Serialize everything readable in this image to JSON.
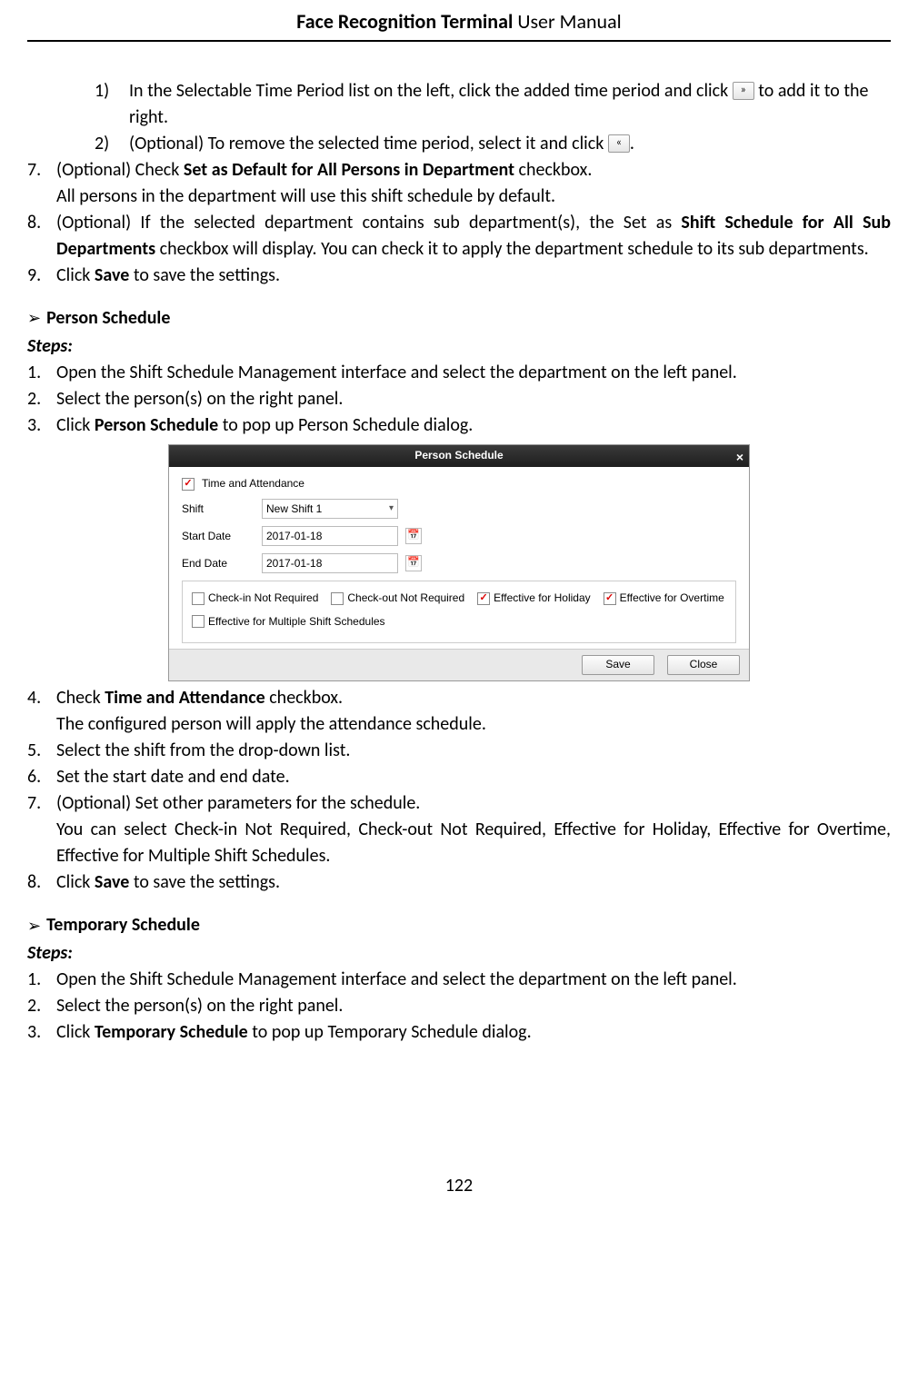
{
  "header": {
    "left": "Face Recognition Terminal",
    "right": " User Manual"
  },
  "page_number": "122",
  "icons": {
    "move_right": "»",
    "move_left": "«"
  },
  "buttons": {
    "save": "Save",
    "close": "Close"
  },
  "nums": {
    "s1": "1)",
    "s2": "2)",
    "n7": "7.",
    "n8": "8.",
    "n9": "9.",
    "p1": "1.",
    "p2": "2.",
    "p3": "3.",
    "p4": "4.",
    "p5": "5.",
    "p6": "6.",
    "p7": "7.",
    "p8": "8.",
    "t1": "1.",
    "t2": "2.",
    "t3": "3."
  },
  "top": {
    "sub1a": "In the Selectable Time Period list on the left, click the added time period and click ",
    "sub1b": "to add it to the right.",
    "sub2a": "(Optional) To remove the selected time period, select it and click ",
    "sub2b": ".",
    "n7a": "(Optional) Check ",
    "n7b": "Set as Default for All Persons in Department",
    "n7c": " checkbox.",
    "n7d": "All persons in the department will use this shift schedule by default.",
    "n8a": "(Optional) If the selected department contains sub department(s), the Set as ",
    "n8b": "Shift Schedule for All Sub Departments",
    "n8c": " checkbox will display. You can check it to apply the department schedule to its sub departments.",
    "n9a": "Click ",
    "n9b": "Save",
    "n9c": " to save the settings."
  },
  "ps": {
    "heading": "Person Schedule",
    "steps": "Steps:",
    "s1": "Open the Shift Schedule Management interface and select the department on the left panel.",
    "s2": "Select the person(s) on the right panel.",
    "s3a": "Click ",
    "s3b": "Person Schedule",
    "s3c": " to pop up Person Schedule dialog.",
    "s4a": "Check ",
    "s4b": "Time and Attendance",
    "s4c": " checkbox.",
    "s4d": "The configured person will apply the attendance schedule.",
    "s5": "Select the shift from the drop-down list.",
    "s6": "Set the start date and end date.",
    "s7a": "(Optional) Set other parameters for the schedule.",
    "s7b": "You can select Check-in Not Required, Check-out Not Required, Effective for Holiday, Effective for Overtime, Effective for Multiple Shift Schedules.",
    "s8a": "Click ",
    "s8b": "Save",
    "s8c": " to save the settings."
  },
  "ts": {
    "heading": "Temporary Schedule",
    "steps": "Steps:",
    "s1": "Open the Shift Schedule Management interface and select the department on the left panel.",
    "s2": "Select the person(s) on the right panel.",
    "s3a": "Click ",
    "s3b": "Temporary Schedule",
    "s3c": " to pop up Temporary Schedule dialog."
  },
  "dialog": {
    "title": "Person Schedule",
    "taa": "Time and Attendance",
    "shift": "Shift",
    "shiftval": "New Shift 1",
    "start": "Start Date",
    "startval": "2017-01-18",
    "end": "End Date",
    "endval": "2017-01-18",
    "opt1": "Check-in Not Required",
    "opt2": "Check-out Not Required",
    "opt3": "Effective for Holiday",
    "opt4": "Effective for Overtime",
    "opt5": "Effective for Multiple Shift Schedules"
  }
}
